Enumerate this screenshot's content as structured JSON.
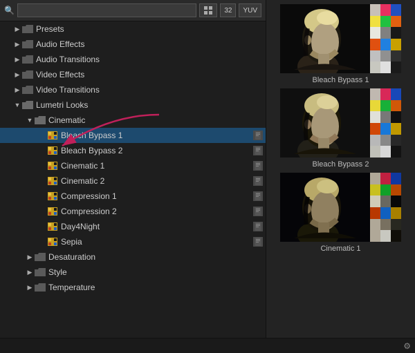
{
  "search": {
    "placeholder": "",
    "value": ""
  },
  "toolbar": {
    "btn1": "⚙",
    "btn2": "32",
    "btn3": "YUV"
  },
  "tree": {
    "items": [
      {
        "id": "presets",
        "label": "Presets",
        "indent": 1,
        "type": "folder",
        "expanded": false,
        "arrow": "▶"
      },
      {
        "id": "audio-effects",
        "label": "Audio Effects",
        "indent": 1,
        "type": "folder",
        "expanded": false,
        "arrow": "▶"
      },
      {
        "id": "audio-transitions",
        "label": "Audio Transitions",
        "indent": 1,
        "type": "folder",
        "expanded": false,
        "arrow": "▶"
      },
      {
        "id": "video-effects",
        "label": "Video Effects",
        "indent": 1,
        "type": "folder",
        "expanded": false,
        "arrow": "▶"
      },
      {
        "id": "video-transitions",
        "label": "Video Transitions",
        "indent": 1,
        "type": "folder",
        "expanded": false,
        "arrow": "▶"
      },
      {
        "id": "lumetri-looks",
        "label": "Lumetri Looks",
        "indent": 1,
        "type": "folder",
        "expanded": true,
        "arrow": "▼"
      },
      {
        "id": "cinematic",
        "label": "Cinematic",
        "indent": 2,
        "type": "folder",
        "expanded": true,
        "arrow": "▼"
      },
      {
        "id": "bleach-bypass-1",
        "label": "Bleach Bypass 1",
        "indent": 3,
        "type": "lut",
        "selected": true
      },
      {
        "id": "bleach-bypass-2",
        "label": "Bleach Bypass 2",
        "indent": 3,
        "type": "lut",
        "selected": false
      },
      {
        "id": "cinematic-1",
        "label": "Cinematic 1",
        "indent": 3,
        "type": "lut",
        "selected": false
      },
      {
        "id": "cinematic-2",
        "label": "Cinematic 2",
        "indent": 3,
        "type": "lut",
        "selected": false
      },
      {
        "id": "compression-1",
        "label": "Compression 1",
        "indent": 3,
        "type": "lut",
        "selected": false
      },
      {
        "id": "compression-2",
        "label": "Compression 2",
        "indent": 3,
        "type": "lut",
        "selected": false
      },
      {
        "id": "day4night",
        "label": "Day4Night",
        "indent": 3,
        "type": "lut",
        "selected": false
      },
      {
        "id": "sepia",
        "label": "Sepia",
        "indent": 3,
        "type": "lut",
        "selected": false
      },
      {
        "id": "desaturation",
        "label": "Desaturation",
        "indent": 2,
        "type": "folder",
        "expanded": false,
        "arrow": "▶"
      },
      {
        "id": "style",
        "label": "Style",
        "indent": 2,
        "type": "folder",
        "expanded": false,
        "arrow": "▶"
      },
      {
        "id": "temperature",
        "label": "Temperature",
        "indent": 2,
        "type": "folder",
        "expanded": false,
        "arrow": "▶"
      }
    ]
  },
  "previews": [
    {
      "id": "preview-bleach-bypass-1",
      "label": "Bleach Bypass 1",
      "colors": [
        "#c8c8c0",
        "#e83060",
        "#2050c0",
        "#f0e040",
        "#20c040",
        "#e06010",
        "#e8e8e8",
        "#606060",
        "#181818",
        "#e05010",
        "#2080e0",
        "#c8a000",
        "#c8c8c0",
        "#909090",
        "#404040",
        "#c8c8c0",
        "#e8e8e8",
        "#282828"
      ]
    },
    {
      "id": "preview-bleach-bypass-2",
      "label": "Bleach Bypass 2",
      "colors": [
        "#c0c0b8",
        "#d82858",
        "#1848b8",
        "#e0d838",
        "#18b038",
        "#d05808",
        "#e0e0d8",
        "#585858",
        "#101010",
        "#d04808",
        "#1878d8",
        "#c09800",
        "#c0c0b8",
        "#888888",
        "#383838",
        "#c0c0b8",
        "#e0e0e0",
        "#202020"
      ]
    },
    {
      "id": "preview-cinematic-1",
      "label": "Cinematic 1",
      "colors": [
        "#b8b0a0",
        "#c02040",
        "#1038a0",
        "#c8c020",
        "#10a028",
        "#b84800",
        "#d0ccc0",
        "#484840",
        "#080808",
        "#b83800",
        "#1060c0",
        "#a88000",
        "#b8b0a0",
        "#787060",
        "#303028",
        "#b8b0a0",
        "#d0d0c8",
        "#181810"
      ]
    }
  ],
  "bottom": {
    "icon1": "🔧"
  }
}
